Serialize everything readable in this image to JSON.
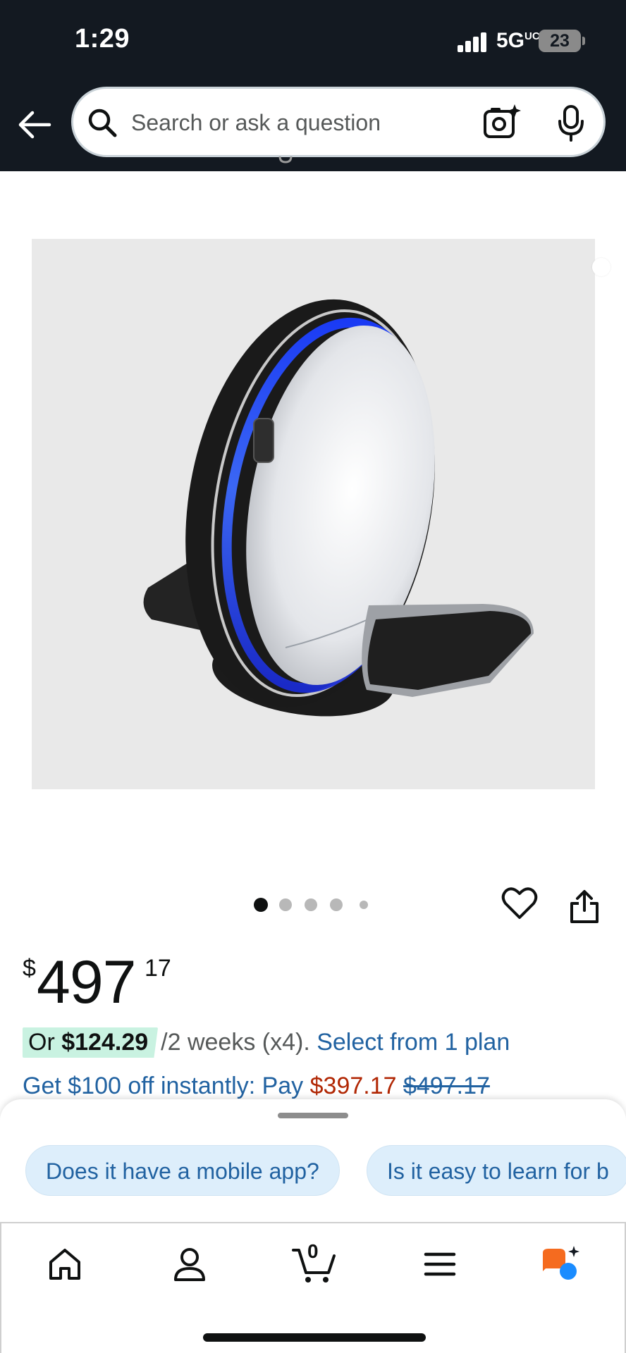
{
  "status_bar": {
    "time": "1:29",
    "network": "5G",
    "network_sup": "UC",
    "battery": "23"
  },
  "search": {
    "placeholder": "Search or ask a question"
  },
  "carousel": {
    "current_index": 1,
    "total": 5
  },
  "price": {
    "symbol": "$",
    "whole": "497",
    "fraction": "17"
  },
  "installment": {
    "prefix": "Or",
    "amount": "$124.29",
    "period": "/2 weeks (x4).",
    "link": "Select from 1 plan"
  },
  "offer": {
    "text": "Get $100 off instantly: Pay",
    "new_price": "$397.17",
    "old_price": "$497.17"
  },
  "suggestions": [
    "Does it have a mobile app?",
    "Is it easy to learn for b"
  ],
  "tabbar": {
    "cart_count": "0"
  },
  "colors": {
    "header_bg": "#131921",
    "link_blue": "#2162a1",
    "price_red": "#b12704",
    "installment_bg": "#c9f2e1",
    "chip_bg": "#ddeefb",
    "rufus_orange": "#f56b1f",
    "rufus_blue": "#1a8cff"
  },
  "icons": [
    "back-arrow-icon",
    "search-icon",
    "camera-icon",
    "microphone-icon",
    "heart-icon",
    "share-icon",
    "home-icon",
    "account-icon",
    "cart-icon",
    "menu-icon",
    "rufus-icon"
  ]
}
